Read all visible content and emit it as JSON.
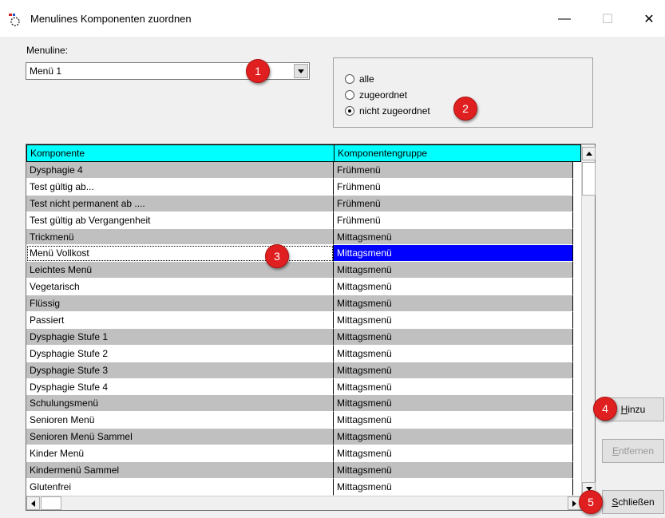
{
  "window": {
    "title": "Menulines Komponenten zuordnen",
    "minimize_glyph": "—",
    "maximize_glyph": "☐",
    "close_glyph": "✕"
  },
  "menuline": {
    "label": "Menuline:",
    "selected": "Menü 1"
  },
  "filter": {
    "options": [
      {
        "label": "alle",
        "checked": false
      },
      {
        "label": "zugeordnet",
        "checked": false
      },
      {
        "label": "nicht zugeordnet",
        "checked": true
      }
    ]
  },
  "grid": {
    "columns": [
      "Komponente",
      "Komponentengruppe"
    ],
    "rows": [
      {
        "komponente": "Dysphagie 4",
        "gruppe": "Frühmenü"
      },
      {
        "komponente": "Test gültig ab...",
        "gruppe": "Frühmenü"
      },
      {
        "komponente": "Test nicht permanent ab ....",
        "gruppe": "Frühmenü"
      },
      {
        "komponente": "Test gültig ab Vergangenheit",
        "gruppe": "Frühmenü"
      },
      {
        "komponente": "Trickmenü",
        "gruppe": "Mittagsmenü"
      },
      {
        "komponente": "Menü Vollkost",
        "gruppe": "Mittagsmenü"
      },
      {
        "komponente": "Leichtes Menü",
        "gruppe": "Mittagsmenü"
      },
      {
        "komponente": "Vegetarisch",
        "gruppe": "Mittagsmenü"
      },
      {
        "komponente": "Flüssig",
        "gruppe": "Mittagsmenü"
      },
      {
        "komponente": "Passiert",
        "gruppe": "Mittagsmenü"
      },
      {
        "komponente": "Dysphagie Stufe 1",
        "gruppe": "Mittagsmenü"
      },
      {
        "komponente": "Dysphagie Stufe 2",
        "gruppe": "Mittagsmenü"
      },
      {
        "komponente": "Dysphagie Stufe 3",
        "gruppe": "Mittagsmenü"
      },
      {
        "komponente": "Dysphagie Stufe 4",
        "gruppe": "Mittagsmenü"
      },
      {
        "komponente": "Schulungsmenü",
        "gruppe": "Mittagsmenü"
      },
      {
        "komponente": "Senioren Menü",
        "gruppe": "Mittagsmenü"
      },
      {
        "komponente": "Senioren Menü Sammel",
        "gruppe": "Mittagsmenü"
      },
      {
        "komponente": "Kinder Menü",
        "gruppe": "Mittagsmenü"
      },
      {
        "komponente": "Kindermenü Sammel",
        "gruppe": "Mittagsmenü"
      },
      {
        "komponente": "Glutenfrei",
        "gruppe": "Mittagsmenü"
      }
    ],
    "selected_row": "Menü Vollkost"
  },
  "buttons": {
    "hinzu": {
      "accel": "H",
      "rest": "inzu"
    },
    "entfernen": {
      "accel": "E",
      "rest": "ntfernen"
    },
    "schliessen": {
      "accel": "S",
      "rest": "chließen"
    }
  },
  "markers": [
    "1",
    "2",
    "3",
    "4",
    "5"
  ],
  "colors": {
    "header_bg": "#00ffff",
    "selection_bg": "#0000ff",
    "alt_row_bg": "#c0c0c0",
    "marker": "#e02020"
  }
}
